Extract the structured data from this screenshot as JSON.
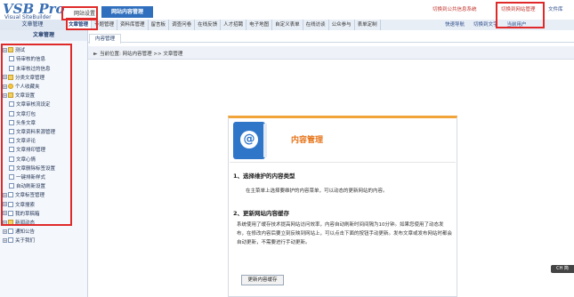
{
  "header": {
    "logo_text": "VSB Pro",
    "logo_subtitle": "Visual SiteBuilder",
    "site_tab": "网站设置",
    "active_tab": "网站内容管理",
    "switch_public": "切换到公共信息系统",
    "switch_web": "切换到网站管理",
    "file_library": "文件库"
  },
  "nav": {
    "section_label": "文章管理",
    "items": [
      "文章管理",
      "专题管理",
      "资料库管理",
      "留言板",
      "调查问卷",
      "在线反馈",
      "人才招聘",
      "电子地图",
      "自定义表单",
      "在线访谈",
      "公众参与",
      "表单定制"
    ],
    "right_items": [
      "快速导航",
      "切换到文字",
      "当前用户"
    ]
  },
  "sidebar": {
    "title": "文章管理",
    "items": [
      {
        "label": "测试",
        "level": 0,
        "icon": "folder-icon"
      },
      {
        "label": "待审核的信息",
        "level": 1,
        "icon": "doc-icon"
      },
      {
        "label": "未审核过的信息",
        "level": 1,
        "icon": "doc-icon"
      },
      {
        "label": "分类文章管理",
        "level": 0,
        "icon": "folder-icon"
      },
      {
        "label": "个人收藏夹",
        "level": 0,
        "icon": "star-icon"
      },
      {
        "label": "文章设置",
        "level": 0,
        "icon": "folder-icon"
      },
      {
        "label": "文章审核流设定",
        "level": 1,
        "icon": "doc-icon"
      },
      {
        "label": "文章打包",
        "level": 1,
        "icon": "doc-icon"
      },
      {
        "label": "头条文章",
        "level": 1,
        "icon": "doc-icon"
      },
      {
        "label": "文章资料来源管理",
        "level": 1,
        "icon": "doc-icon"
      },
      {
        "label": "文章评论",
        "level": 1,
        "icon": "doc-icon"
      },
      {
        "label": "文章排印管理",
        "level": 1,
        "icon": "doc-icon"
      },
      {
        "label": "文章心情",
        "level": 1,
        "icon": "doc-icon"
      },
      {
        "label": "文章删除标签设置",
        "level": 1,
        "icon": "doc-icon"
      },
      {
        "label": "一键排新样式",
        "level": 1,
        "icon": "doc-icon"
      },
      {
        "label": "自动刷新设置",
        "level": 1,
        "icon": "doc-icon"
      },
      {
        "label": "文章标签管理",
        "level": 0,
        "icon": "doc-icon"
      },
      {
        "label": "文章搜索",
        "level": 0,
        "icon": "doc-icon"
      },
      {
        "label": "我的草稿箱",
        "level": 0,
        "icon": "doc-icon"
      },
      {
        "label": "新闻动态",
        "level": 0,
        "icon": "folder-icon"
      },
      {
        "label": "通知公告",
        "level": 0,
        "icon": "doc-icon"
      },
      {
        "label": "关于我们",
        "level": 0,
        "icon": "doc-icon"
      }
    ]
  },
  "main": {
    "tab_label": "内容管理",
    "breadcrumb": "当前位置: 网站内容管理 >> 文章管理",
    "panel": {
      "title": "内容管理",
      "section1_title": "1、选择维护的内容类型",
      "section1_text": "在主菜单上选择要维护的内容菜单，可以动态的更新网站的内容。",
      "section2_title": "2、更新网站内容缓存",
      "section2_text": "系统使用了缓存技术提高网站访问效率，内容自动刷新时间间隔为10分钟。如果您使用了动态发布，在修改内容后要立刻反映到网站上，可以点击下面的按钮手动更新。发布文章或发布网站时都会自动更新，不需要进行手动更新。",
      "refresh_button": "更新内容缓存"
    }
  },
  "float_widget": "CH 简"
}
